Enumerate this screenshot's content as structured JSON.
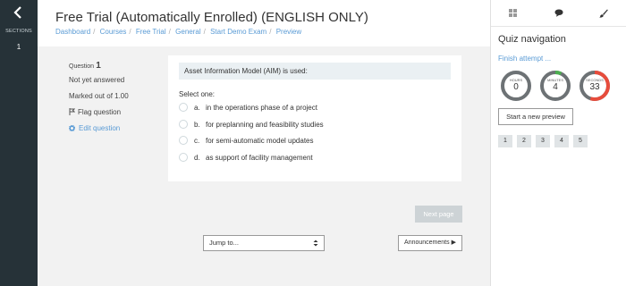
{
  "left_sidebar": {
    "sections_label": "SECTIONS",
    "section_number": "1"
  },
  "header": {
    "title": "Free Trial (Automatically Enrolled) (ENGLISH ONLY)",
    "breadcrumbs": [
      "Dashboard",
      "Courses",
      "Free Trial",
      "General",
      "Start Demo Exam",
      "Preview"
    ]
  },
  "question_info": {
    "question_label": "Question",
    "question_number": "1",
    "status": "Not yet answered",
    "marked_out_of": "Marked out of 1.00",
    "flag_label": "Flag question",
    "edit_label": "Edit question"
  },
  "question": {
    "text": "Asset Information Model (AIM) is used:",
    "select_one": "Select one:",
    "options": [
      {
        "letter": "a.",
        "text": "in the operations phase of a project"
      },
      {
        "letter": "b.",
        "text": "for preplanning and feasibility studies"
      },
      {
        "letter": "c.",
        "text": "for semi-automatic model updates"
      },
      {
        "letter": "d.",
        "text": "as support of facility management"
      }
    ]
  },
  "navigation": {
    "next_label": "Next page",
    "jump_label": "Jump to...",
    "announcements_label": "Announcements ▶"
  },
  "drawer": {
    "title": "Quiz navigation",
    "finish_label": "Finish attempt ...",
    "timers": [
      {
        "label": "HOURS",
        "value": "0",
        "color": "#6d7275",
        "fraction": 1.0
      },
      {
        "label": "MINUTES",
        "value": "4",
        "color": "#4caf50",
        "fraction": 0.07
      },
      {
        "label": "SECONDS",
        "value": "33",
        "color": "#e74c3c",
        "fraction": 0.55
      }
    ],
    "preview_label": "Start a new preview",
    "pages": [
      "1",
      "2",
      "3",
      "4",
      "5"
    ]
  },
  "colors": {
    "accent_link": "#5a9bd5",
    "dark_sidebar": "#263238"
  }
}
